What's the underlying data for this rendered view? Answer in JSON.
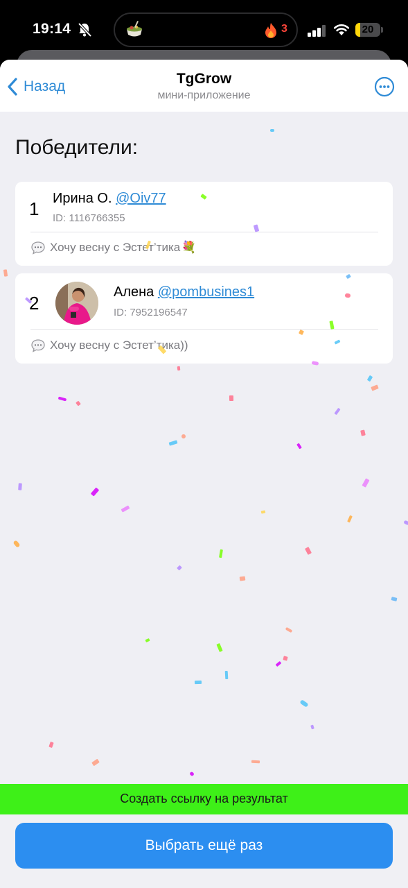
{
  "status_bar": {
    "time": "19:14",
    "notification_count": "3",
    "battery_level": "20",
    "battery_fraction": 0.2
  },
  "nav": {
    "back_label": "Назад",
    "title": "TgGrow",
    "subtitle": "мини-приложение"
  },
  "section_title": "Победители:",
  "winners": [
    {
      "place": "1",
      "name": "Ирина О.",
      "username": "@Oiv77",
      "id": "ID: 1116766355",
      "comment": "Хочу весну с Эстет’тика",
      "comment_emoji": "💐"
    },
    {
      "place": "2",
      "name": "Алена",
      "username": "@pombusines1",
      "id": "ID: 7952196547",
      "comment": "Хочу весну с Эстет’тика))"
    }
  ],
  "link_button_label": "Создать ссылку на результат",
  "main_button_label": "Выбрать ещё раз",
  "colors": {
    "accent": "#2c8ef0",
    "link": "#2f8bd6",
    "green_bar": "#3ef018",
    "page_bg": "#efeff4"
  },
  "icons": [
    "bell-slash-icon",
    "app-bowl-icon",
    "flame-icon",
    "signal-icon",
    "wifi-icon",
    "battery-icon",
    "back-chevron-icon",
    "more-icon",
    "speech-bubble-icon",
    "flower-bouquet-icon"
  ]
}
